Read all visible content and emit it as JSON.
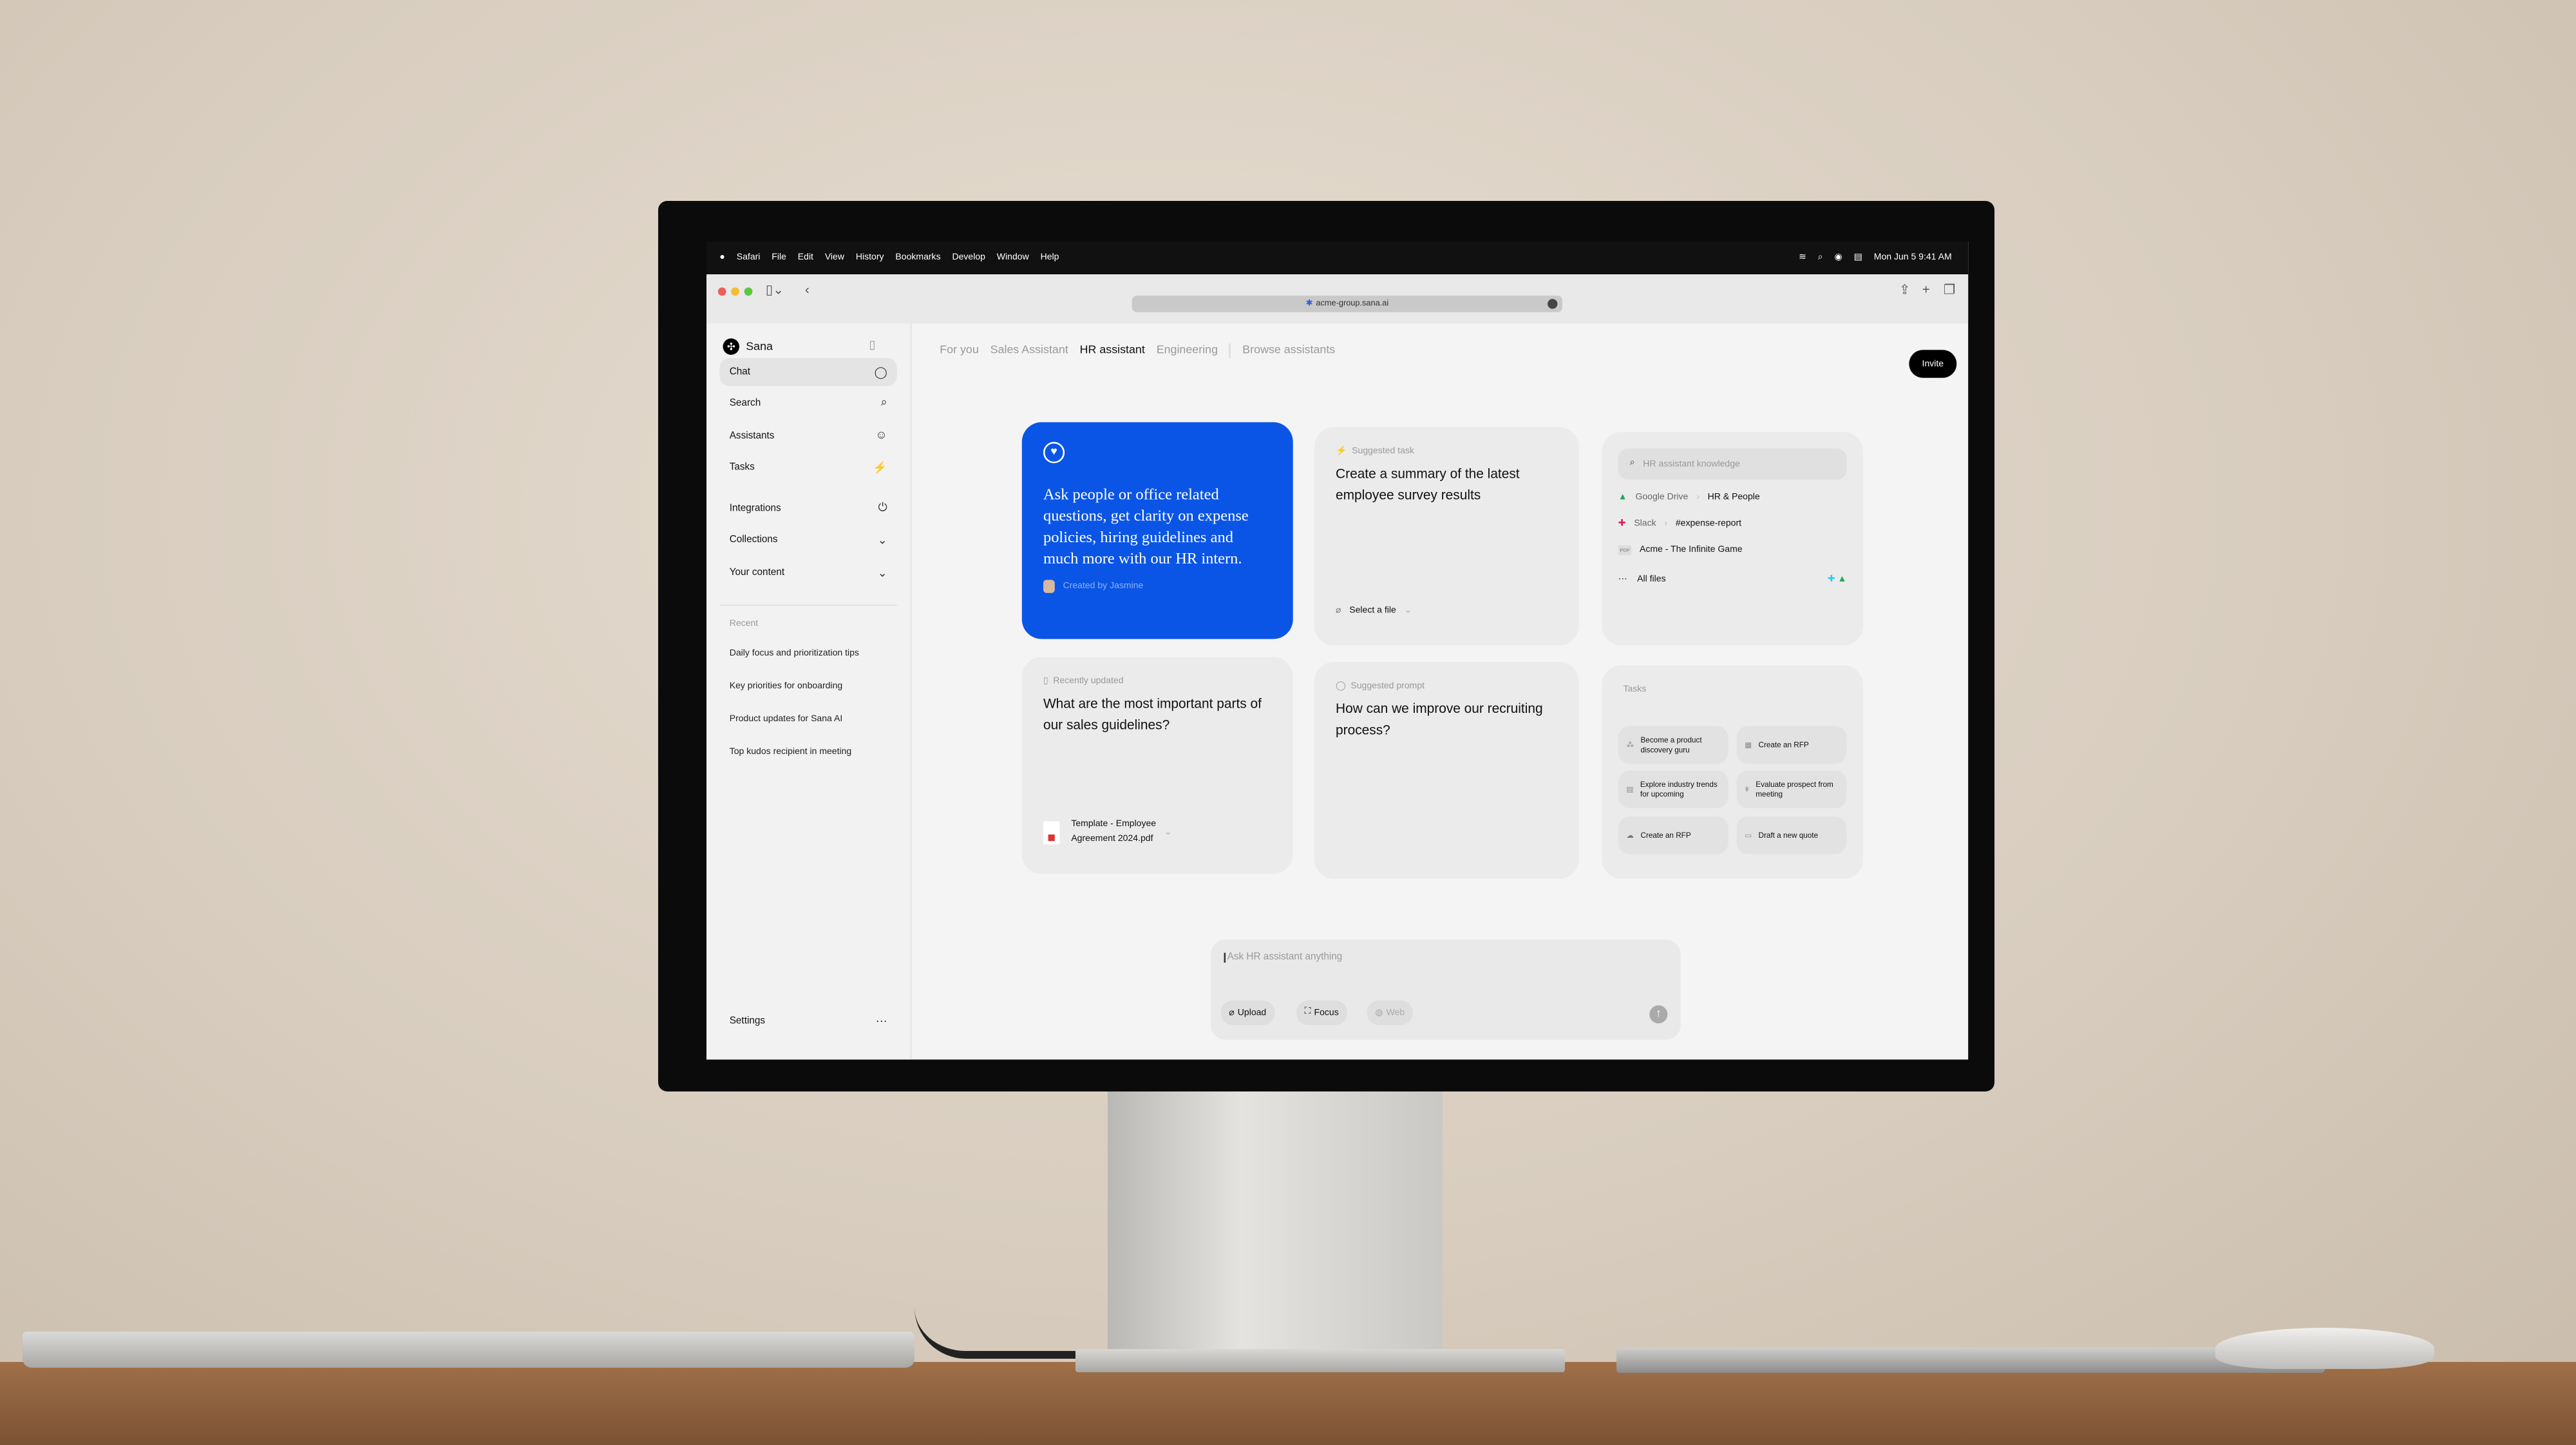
{
  "menubar": {
    "apple": "",
    "items": [
      "Safari",
      "File",
      "Edit",
      "View",
      "History",
      "Bookmarks",
      "Develop",
      "Window",
      "Help"
    ],
    "clock": "Mon Jun 5  9:41 AM"
  },
  "browser": {
    "url": "acme-group.sana.ai"
  },
  "sidebar": {
    "brand": "Sana",
    "nav": [
      {
        "label": "Chat",
        "icon": "chat-bubble-icon",
        "glyph": "◯"
      },
      {
        "label": "Search",
        "icon": "search-icon",
        "glyph": "⌕"
      },
      {
        "label": "Assistants",
        "icon": "masks-icon",
        "glyph": "☺"
      },
      {
        "label": "Tasks",
        "icon": "bolt-icon",
        "glyph": "⚡"
      }
    ],
    "nav2": [
      {
        "label": "Integrations",
        "icon": "plug-icon",
        "glyph": "⏻"
      },
      {
        "label": "Collections",
        "icon": "chevron-down-icon",
        "glyph": "⌄"
      },
      {
        "label": "Your content",
        "icon": "chevron-down-icon",
        "glyph": "⌄"
      }
    ],
    "recent_heading": "Recent",
    "recent": [
      "Daily focus and prioritization tips",
      "Key priorities for onboarding",
      "Product updates for Sana AI",
      "Top kudos recipient in meeting"
    ],
    "settings": "Settings"
  },
  "tabs": [
    "For you",
    "Sales Assistant",
    "HR assistant",
    "Engineering"
  ],
  "browse": "Browse assistants",
  "invite": "Invite",
  "assistant_card": {
    "description": "Ask people or office related questions, get clarity on expense policies, hiring guidelines and much more with our HR intern.",
    "creator": "Created by Jasmine",
    "color": "#0a55e6"
  },
  "task_card": {
    "label": "Suggested task",
    "title": "Create a summary of the latest employee survey results",
    "file_select": "Select a file"
  },
  "knowledge_card": {
    "search_placeholder": "HR assistant knowledge",
    "sources": [
      {
        "app": "Google Drive",
        "target": "HR & People"
      },
      {
        "app": "Slack",
        "target": "#expense-report"
      },
      {
        "app": "PDF",
        "target": "Acme - The Infinite Game"
      }
    ],
    "all_files": "All files"
  },
  "recent_card": {
    "label": "Recently updated",
    "title": "What are the most important parts of our sales guidelines?",
    "file": "Template - Employee Agreement 2024.pdf",
    "file_line1": "Template - Employee",
    "file_line2": "Agreement 2024.pdf"
  },
  "prompt_card": {
    "label": "Suggested prompt",
    "title": "How can we improve our recruiting process?"
  },
  "tasks_card": {
    "heading": "Tasks",
    "items": [
      "Become a product discovery guru",
      "Create an RFP",
      "Explore industry trends for upcoming",
      "Evaluate prospect from meeting",
      "Create an RFP",
      "Draft a new quote"
    ]
  },
  "composer": {
    "placeholder": "Ask HR assistant anything",
    "upload": "Upload",
    "focus": "Focus",
    "web": "Web"
  }
}
